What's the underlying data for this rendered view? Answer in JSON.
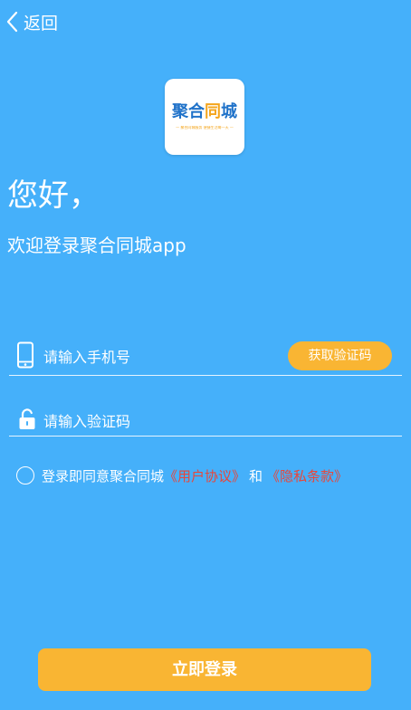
{
  "nav": {
    "back_label": "返回"
  },
  "logo": {
    "title_part1": "聚合",
    "title_part2": "同",
    "title_part3": "城",
    "slogan": "— 聚合同城服务 便捷生活每一天 —"
  },
  "greeting": {
    "hello": "您好，",
    "welcome": "欢迎登录聚合同城app"
  },
  "form": {
    "phone_placeholder": "请输入手机号",
    "get_code_label": "获取验证码",
    "code_placeholder": "请输入验证码"
  },
  "agreement": {
    "prefix": "登录即同意聚合同城",
    "user_agreement": "《用户协议》",
    "and": "和",
    "privacy": "《隐私条款》"
  },
  "actions": {
    "login_label": "立即登录"
  },
  "colors": {
    "background": "#45b0fa",
    "accent": "#f9b533",
    "link": "#e8463a",
    "logo_blue": "#1f72c9"
  }
}
